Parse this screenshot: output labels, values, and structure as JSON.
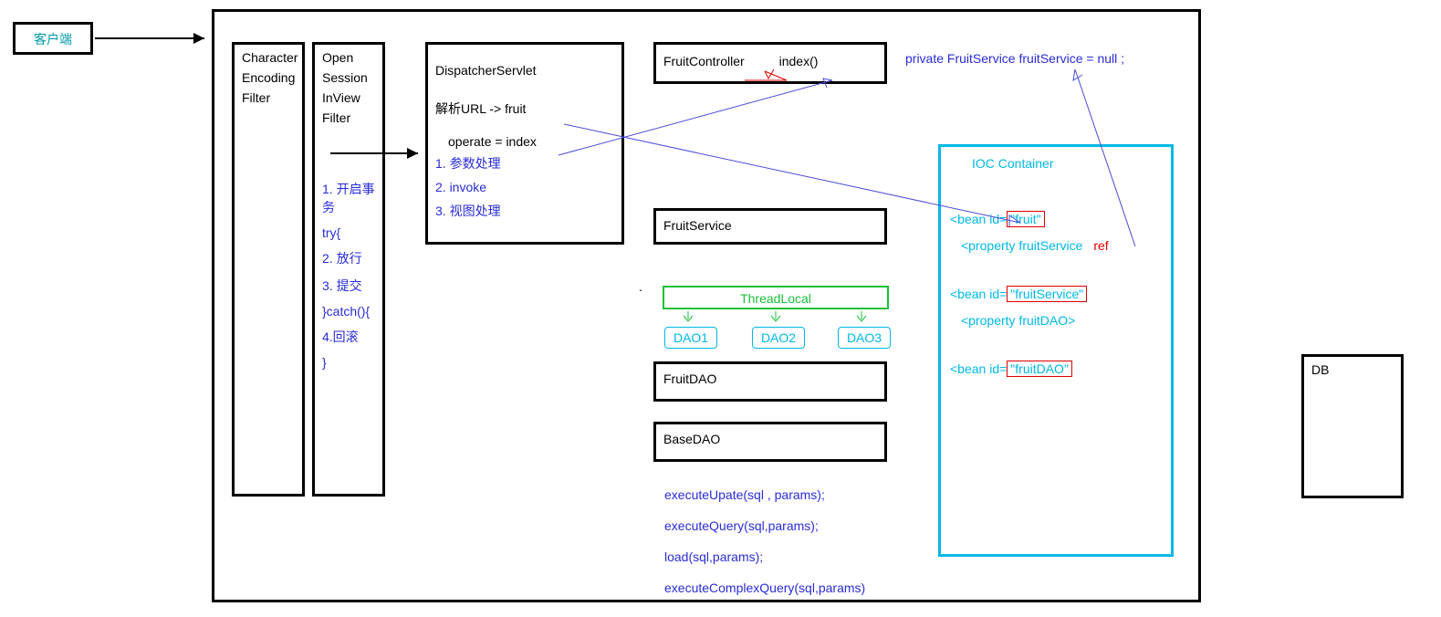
{
  "client": "客户端",
  "filter1": {
    "l1": "Character",
    "l2": "Encoding",
    "l3": "Filter"
  },
  "filter2": {
    "l1": "Open",
    "l2": "Session",
    "l3": "InView",
    "l4": "Filter",
    "s1": "1. 开启事务",
    "s2": "try{",
    "s3": "2. 放行",
    "s4": "3. 提交",
    "s5": "}catch(){",
    "s6": "4.回滚",
    "s7": "}"
  },
  "servlet": {
    "title": "DispatcherServlet",
    "url": "解析URL -> fruit",
    "op": "operate = index",
    "s1": "1. 参数处理",
    "s2": "2. invoke",
    "s3": "3. 视图处理"
  },
  "controller": {
    "name": "FruitController",
    "method": "index()"
  },
  "decl": "private FruitService fruitService = null ;",
  "service": "FruitService",
  "threadlocal": "ThreadLocal",
  "dao1": "DAO1",
  "dao2": "DAO2",
  "dao3": "DAO3",
  "fruitdao": "FruitDAO",
  "basedao": "BaseDAO",
  "m1": "executeUpate(sql , params);",
  "m2": "executeQuery(sql,params);",
  "m3": "load(sql,params);",
  "m4": "executeComplexQuery(sql,params)",
  "ioc": {
    "title": "IOC Container",
    "b1a": "<bean id=",
    "b1b": "\"fruit\"",
    "p1": "<property fruitService",
    "ref": "ref",
    "b2a": "<bean id=",
    "b2b": "\"fruitService\"",
    "p2": "<property fruitDAO>",
    "b3a": "<bean id=",
    "b3b": "\"fruitDAO\""
  },
  "db": "DB"
}
